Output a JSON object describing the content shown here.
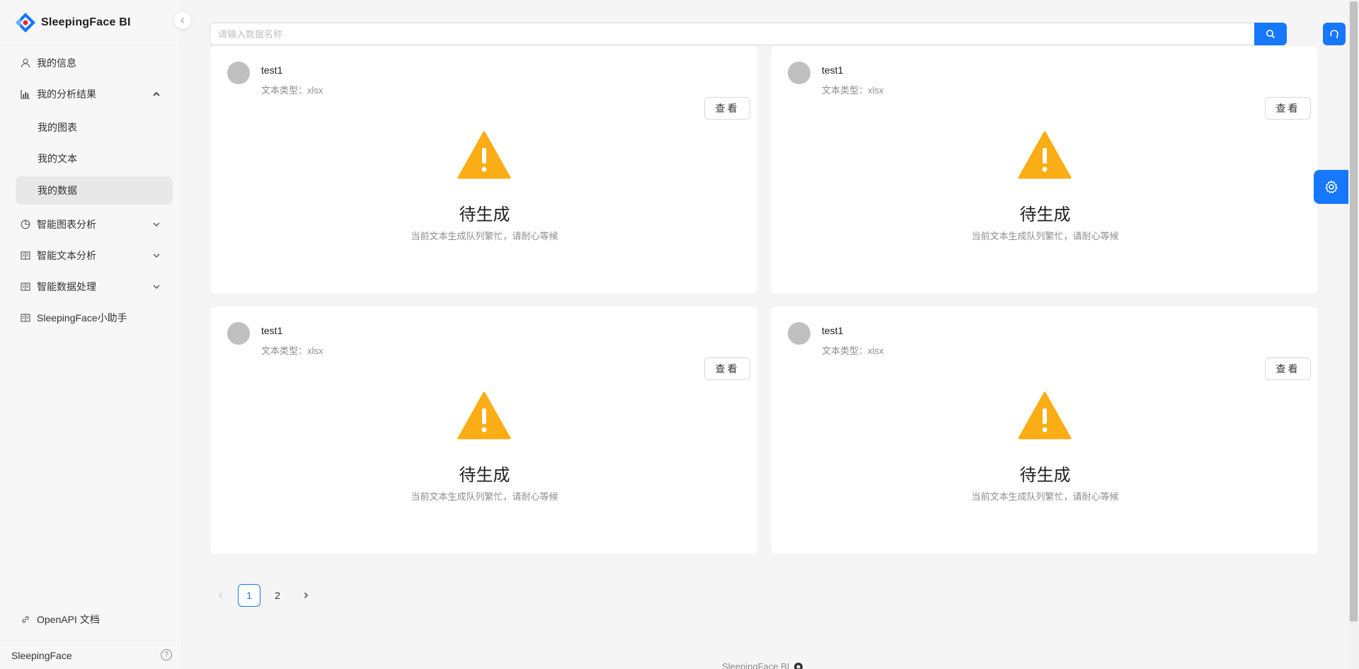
{
  "app": {
    "title": "SleepingFace BI"
  },
  "sidebar": {
    "items": [
      {
        "label": "我的信息",
        "icon": "user-icon"
      },
      {
        "label": "我的分析结果",
        "icon": "bar-chart-icon",
        "expanded": true,
        "children": [
          {
            "label": "我的图表"
          },
          {
            "label": "我的文本"
          },
          {
            "label": "我的数据",
            "active": true
          }
        ]
      },
      {
        "label": "智能图表分析",
        "icon": "pie-chart-icon"
      },
      {
        "label": "智能文本分析",
        "icon": "book-icon"
      },
      {
        "label": "智能数据处理",
        "icon": "book-icon"
      },
      {
        "label": "SleepingFace小助手",
        "icon": "book-icon"
      }
    ],
    "openapi_label": "OpenAPI 文档",
    "user_name": "SleepingFace"
  },
  "search": {
    "placeholder": "请输入数据名称"
  },
  "cards": [
    {
      "title": "test1",
      "subtitle": "文本类型：xlsx",
      "button": "查看",
      "status": "待生成",
      "description": "当前文本生成队列繁忙，请耐心等候"
    },
    {
      "title": "test1",
      "subtitle": "文本类型：xlsx",
      "button": "查看",
      "status": "待生成",
      "description": "当前文本生成队列繁忙，请耐心等候"
    },
    {
      "title": "test1",
      "subtitle": "文本类型：xlsx",
      "button": "查看",
      "status": "待生成",
      "description": "当前文本生成队列繁忙，请耐心等候"
    },
    {
      "title": "test1",
      "subtitle": "文本类型：xlsx",
      "button": "查看",
      "status": "待生成",
      "description": "当前文本生成队列繁忙，请耐心等候"
    }
  ],
  "pagination": {
    "pages": [
      "1",
      "2"
    ],
    "current": "1"
  },
  "footer": {
    "text": "SleepingFace BI"
  },
  "colors": {
    "primary": "#1677ff",
    "warning": "#faad14",
    "avatar": "#bfbfbf"
  }
}
